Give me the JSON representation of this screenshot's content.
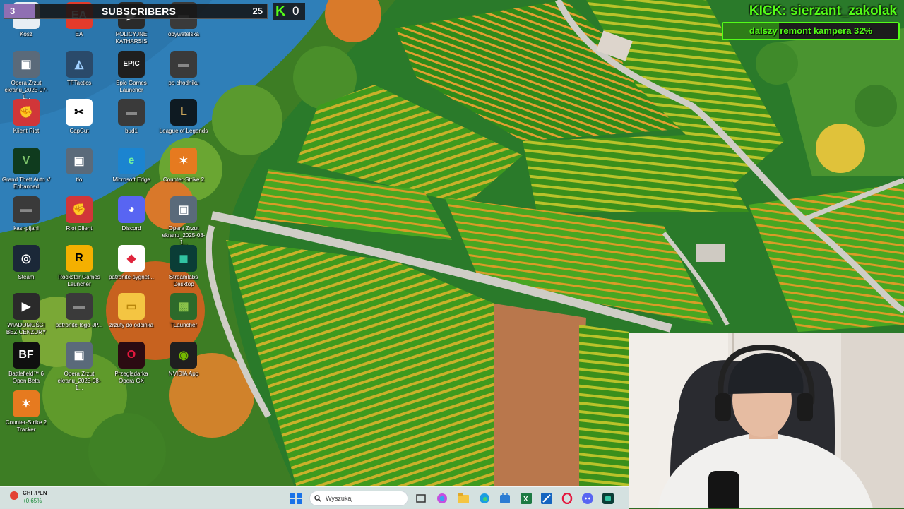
{
  "overlay": {
    "subscriber_widget": {
      "left_count": "3",
      "title": "SUBSCRIBERS",
      "right_count": "25"
    },
    "kick_counter": {
      "logo": "K",
      "value": "0"
    },
    "kick_handle": "KICK: sierzant_zakolak",
    "goal": {
      "text": "dalszy remont kampera 32%",
      "progress_percent": 32
    }
  },
  "desktop_icons": [
    {
      "label": "Kosz",
      "icon": "recycle-bin-icon"
    },
    {
      "label": "EA",
      "icon": "ea-icon"
    },
    {
      "label": "POLICYJNE KATHARSIS",
      "icon": "video-file-icon"
    },
    {
      "label": "obywatelska",
      "icon": "file-icon"
    },
    {
      "label": "Opera Zrzut ekranu_2025-07-1...",
      "icon": "image-file-icon"
    },
    {
      "label": "TFTactics",
      "icon": "tftactics-icon"
    },
    {
      "label": "Epic Games Launcher",
      "icon": "epic-games-icon"
    },
    {
      "label": "po chodniku",
      "icon": "file-icon"
    },
    {
      "label": "Klient Riot",
      "icon": "riot-icon"
    },
    {
      "label": "CapCut",
      "icon": "capcut-icon"
    },
    {
      "label": "bud1",
      "icon": "file-icon"
    },
    {
      "label": "League of Legends",
      "icon": "league-icon"
    },
    {
      "label": "Grand Theft Auto V Enhanced",
      "icon": "gta-icon"
    },
    {
      "label": "tło",
      "icon": "image-file-icon"
    },
    {
      "label": "Microsoft Edge",
      "icon": "edge-icon"
    },
    {
      "label": "Counter-Strike 2",
      "icon": "cs2-icon"
    },
    {
      "label": "kasi-pijani",
      "icon": "file-icon"
    },
    {
      "label": "Riot Client",
      "icon": "riot-icon"
    },
    {
      "label": "Discord",
      "icon": "discord-icon"
    },
    {
      "label": "Opera Zrzut ekranu_2025-08-1...",
      "icon": "image-file-icon"
    },
    {
      "label": "Steam",
      "icon": "steam-icon"
    },
    {
      "label": "Rockstar Games Launcher",
      "icon": "rockstar-icon"
    },
    {
      "label": "patronite-sygnet...",
      "icon": "patronite-icon"
    },
    {
      "label": "Streamlabs Desktop",
      "icon": "streamlabs-icon"
    },
    {
      "label": "WIADOMOŚCI BEZ CENZURY",
      "icon": "video-file-icon"
    },
    {
      "label": "patronite-logo-JP...",
      "icon": "file-icon"
    },
    {
      "label": "zrzuty do odcinka",
      "icon": "folder-icon"
    },
    {
      "label": "TLauncher",
      "icon": "tlauncher-icon"
    },
    {
      "label": "Battlefield™ 6 Open Beta",
      "icon": "battlefield-icon"
    },
    {
      "label": "Opera Zrzut ekranu_2025-08-1...",
      "icon": "image-file-icon"
    },
    {
      "label": "Przeglądarka Opera GX",
      "icon": "opera-gx-icon"
    },
    {
      "label": "NVIDIA App",
      "icon": "nvidia-icon"
    },
    {
      "label": "Counter-Strike 2 Tracker",
      "icon": "cs2-icon"
    }
  ],
  "taskbar": {
    "widget": {
      "pair": "CHF/PLN",
      "change": "+0,65%"
    },
    "search_placeholder": "Wyszukaj",
    "pinned": [
      "windows-start-icon",
      "task-view-icon",
      "copilot-icon",
      "file-explorer-icon",
      "edge-icon",
      "store-icon",
      "excel-icon",
      "paint-icon",
      "opera-gx-icon",
      "discord-icon",
      "streamlabs-icon"
    ]
  },
  "colors": {
    "kick_green": "#53fc18",
    "subscriber_purple": "#8f6fb3"
  }
}
